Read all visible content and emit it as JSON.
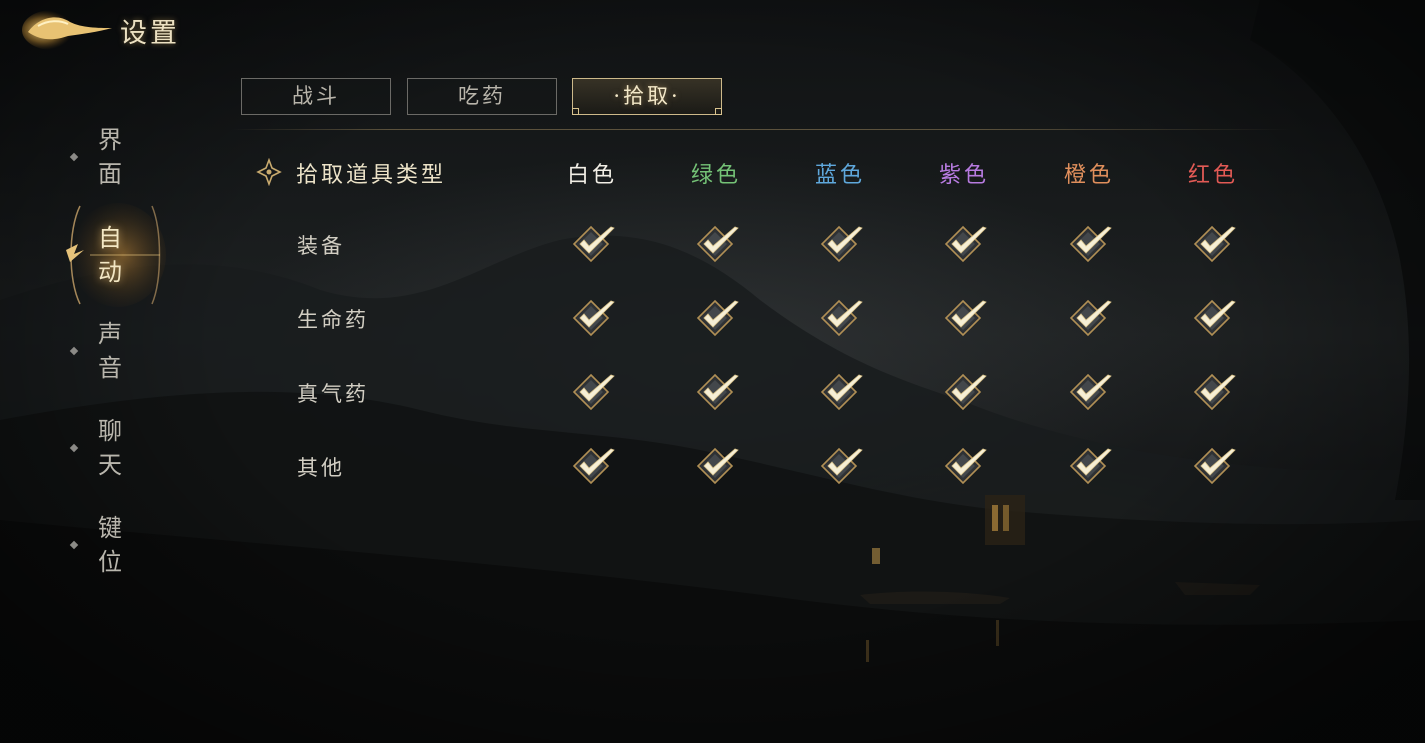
{
  "header": {
    "title": "设置"
  },
  "nav": {
    "items": [
      {
        "label": "界面",
        "active": false
      },
      {
        "label": "自动",
        "active": true
      },
      {
        "label": "声音",
        "active": false
      },
      {
        "label": "聊天",
        "active": false
      },
      {
        "label": "键位",
        "active": false
      }
    ]
  },
  "tabs": [
    {
      "label": "战斗",
      "active": false
    },
    {
      "label": "吃药",
      "active": false
    },
    {
      "label": "·拾取·",
      "active": true
    }
  ],
  "pickup": {
    "header_label": "拾取道具类型",
    "header_icon": "fleur-diamond-icon",
    "columns": [
      {
        "label": "白色",
        "color": "#f2efe6"
      },
      {
        "label": "绿色",
        "color": "#74c276"
      },
      {
        "label": "蓝色",
        "color": "#5fa8dc"
      },
      {
        "label": "紫色",
        "color": "#b77be0"
      },
      {
        "label": "橙色",
        "color": "#e08f5c"
      },
      {
        "label": "红色",
        "color": "#e25a55"
      }
    ],
    "rows": [
      {
        "label": "装备",
        "checked": [
          true,
          true,
          true,
          true,
          true,
          true
        ]
      },
      {
        "label": "生命药",
        "checked": [
          true,
          true,
          true,
          true,
          true,
          true
        ]
      },
      {
        "label": "真气药",
        "checked": [
          true,
          true,
          true,
          true,
          true,
          true
        ]
      },
      {
        "label": "其他",
        "checked": [
          true,
          true,
          true,
          true,
          true,
          true
        ]
      }
    ]
  },
  "colors": {
    "accent_gold": "#d8c08a",
    "text_main": "#d2cec3"
  }
}
